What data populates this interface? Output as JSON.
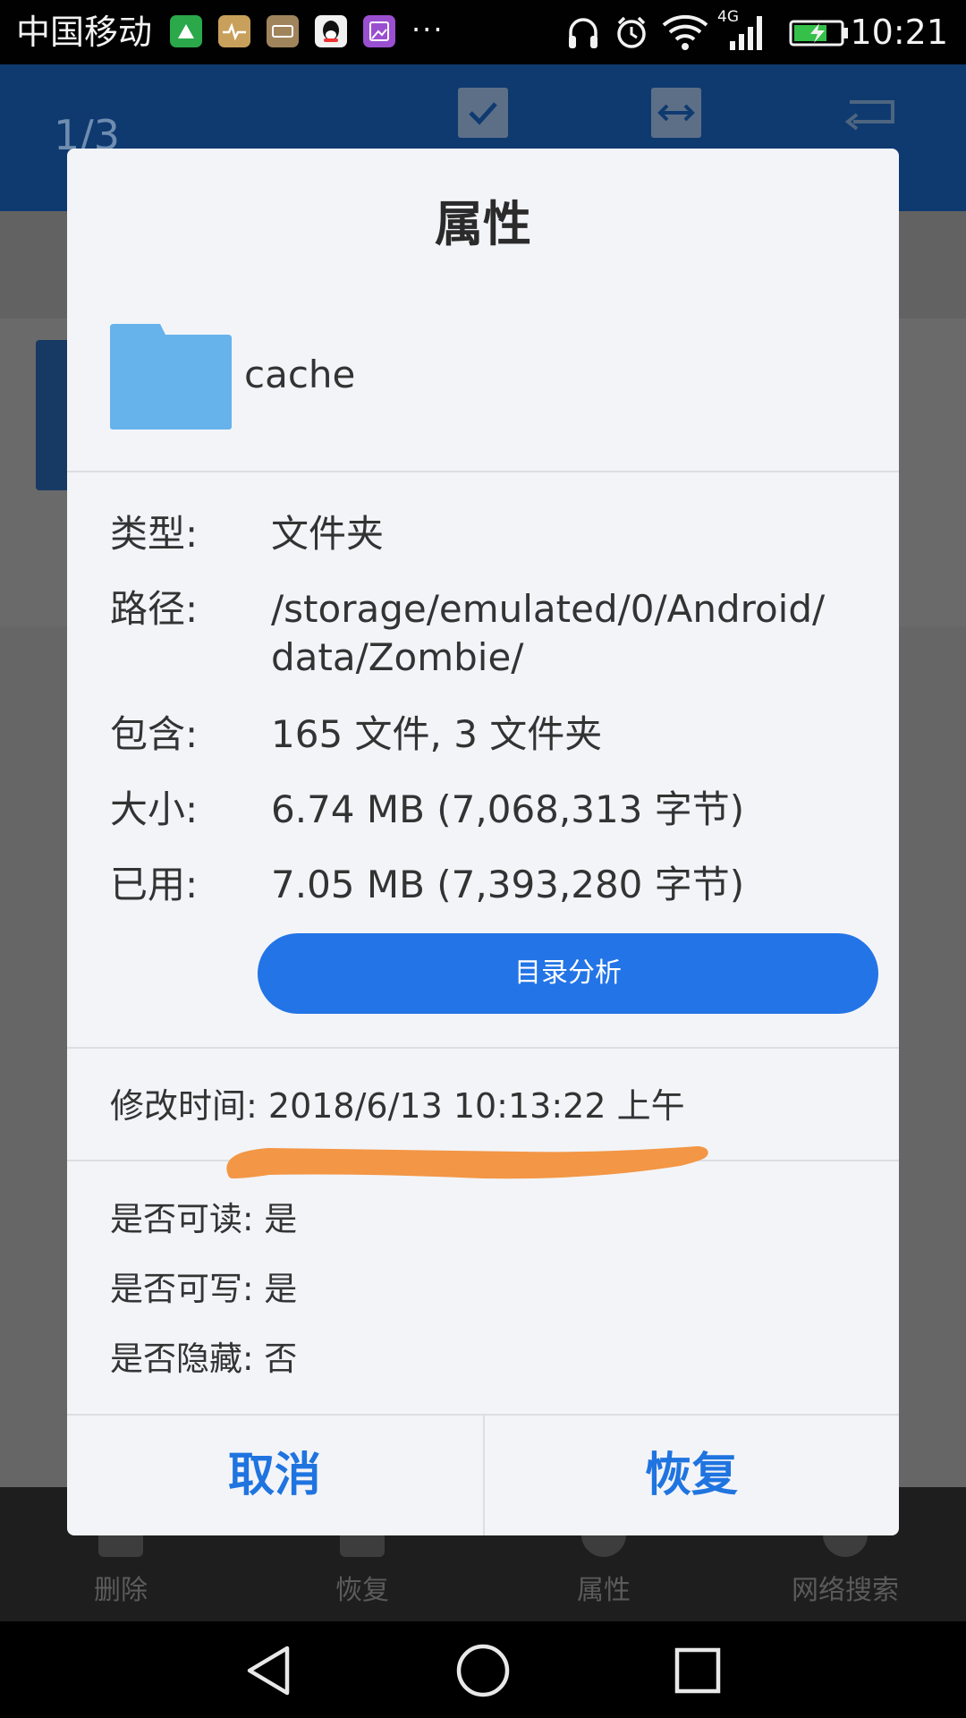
{
  "status_bar": {
    "carrier": "中国移动",
    "more": "···",
    "network": "4G",
    "time": "10:21"
  },
  "background_app": {
    "page_counter": "1/3",
    "bottom_bar": [
      {
        "label": "删除",
        "icon": "trash-icon"
      },
      {
        "label": "恢复",
        "icon": "restore-icon"
      },
      {
        "label": "属性",
        "icon": "info-icon"
      },
      {
        "label": "网络搜索",
        "icon": "web-search-icon"
      }
    ]
  },
  "dialog": {
    "title": "属性",
    "folder": {
      "icon": "folder-icon",
      "icon_color": "#66b3ec",
      "name": "cache"
    },
    "properties": {
      "type": {
        "label": "类型:",
        "value": "文件夹"
      },
      "path": {
        "label": "路径:",
        "value_line1": "/storage/emulated/0/Android/",
        "value_line2": "data/Zombie/"
      },
      "contains": {
        "label": "包含:",
        "value": "165 文件, 3 文件夹"
      },
      "size": {
        "label": "大小:",
        "value": "6.74 MB (7,068,313 字节)"
      },
      "used": {
        "label": "已用:",
        "value": "7.05 MB (7,393,280 字节)"
      }
    },
    "analyze_button": "目录分析",
    "modified": {
      "label": "修改时间:",
      "value": "2018/6/13 10:13:22 上午"
    },
    "permissions": {
      "readable": {
        "label": "是否可读:",
        "value": "是"
      },
      "writable": {
        "label": "是否可写:",
        "value": "是"
      },
      "hidden": {
        "label": "是否隐藏:",
        "value": "否"
      }
    },
    "cancel_button": "取消",
    "restore_button": "恢复"
  },
  "colors": {
    "accent": "#2374e6",
    "button_text": "#1f74e0",
    "annotation": "#f39645",
    "toolbar": "#1f5aa6"
  }
}
